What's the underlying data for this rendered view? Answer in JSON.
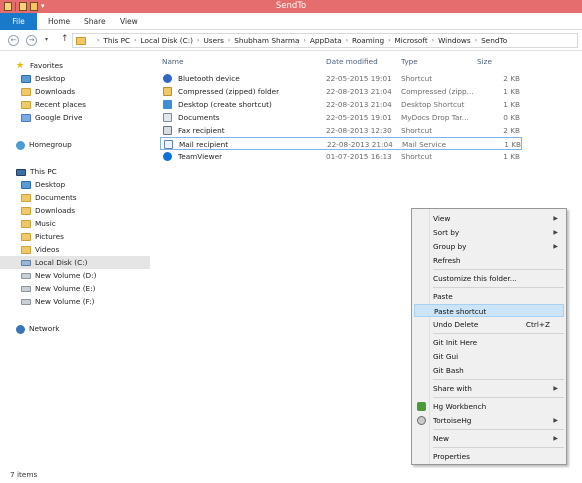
{
  "window": {
    "title": "SendTo"
  },
  "ribbon": {
    "tabs": [
      "File",
      "Home",
      "Share",
      "View"
    ]
  },
  "address": {
    "crumbs": [
      "This PC",
      "Local Disk (C:)",
      "Users",
      "Shubham Sharma",
      "AppData",
      "Roaming",
      "Microsoft",
      "Windows",
      "SendTo"
    ]
  },
  "sidebar": {
    "favorites_label": "Favorites",
    "favorites": [
      "Desktop",
      "Downloads",
      "Recent places",
      "Google Drive"
    ],
    "homegroup": "Homegroup",
    "this_pc": "This PC",
    "pc_items": [
      "Desktop",
      "Documents",
      "Downloads",
      "Music",
      "Pictures",
      "Videos",
      "Local Disk (C:)",
      "New Volume (D:)",
      "New Volume (E:)",
      "New Volume (F:)"
    ],
    "network": "Network"
  },
  "columns": {
    "name": "Name",
    "date": "Date modified",
    "type": "Type",
    "size": "Size"
  },
  "files": [
    {
      "name": "Bluetooth device",
      "date": "22-05-2015 19:01",
      "type": "Shortcut",
      "size": "2 KB",
      "icon": "bluetooth-icon"
    },
    {
      "name": "Compressed (zipped) folder",
      "date": "22-08-2013 21:04",
      "type": "Compressed (zipp...",
      "size": "1 KB",
      "icon": "zip-folder-icon"
    },
    {
      "name": "Desktop (create shortcut)",
      "date": "22-08-2013 21:04",
      "type": "Desktop Shortcut",
      "size": "1 KB",
      "icon": "desktop-icon"
    },
    {
      "name": "Documents",
      "date": "22-05-2015 19:01",
      "type": "MyDocs Drop Tar...",
      "size": "0 KB",
      "icon": "documents-icon"
    },
    {
      "name": "Fax recipient",
      "date": "22-08-2013 12:30",
      "type": "Shortcut",
      "size": "2 KB",
      "icon": "fax-icon"
    },
    {
      "name": "Mail recipient",
      "date": "22-08-2013 21:04",
      "type": "Mail Service",
      "size": "1 KB",
      "icon": "mail-icon"
    },
    {
      "name": "TeamViewer",
      "date": "01-07-2015 16:13",
      "type": "Shortcut",
      "size": "1 KB",
      "icon": "teamviewer-icon"
    }
  ],
  "status": {
    "items": "7 items"
  },
  "context_menu": {
    "view": "View",
    "sort_by": "Sort by",
    "group_by": "Group by",
    "refresh": "Refresh",
    "customize": "Customize this folder...",
    "paste": "Paste",
    "paste_shortcut": "Paste shortcut",
    "undo_delete": "Undo Delete",
    "undo_shortcut": "Ctrl+Z",
    "git_init": "Git Init Here",
    "git_gui": "Git Gui",
    "git_bash": "Git Bash",
    "share_with": "Share with",
    "hg_workbench": "Hg Workbench",
    "tortoisehg": "TortoiseHg",
    "new": "New",
    "properties": "Properties"
  }
}
